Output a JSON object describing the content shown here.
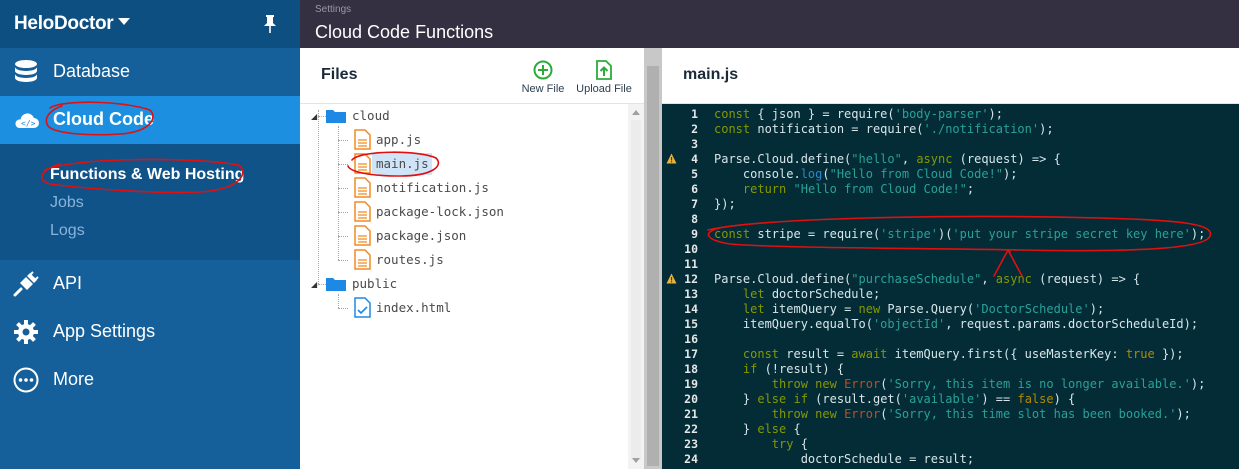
{
  "app": {
    "name": "HeloDoctor"
  },
  "sidebar": {
    "items": [
      {
        "label": "Database",
        "icon": "database-icon"
      },
      {
        "label": "Cloud Code",
        "icon": "cloud-code-icon"
      },
      {
        "label": "API",
        "icon": "plug-icon"
      },
      {
        "label": "App Settings",
        "icon": "gear-icon"
      },
      {
        "label": "More",
        "icon": "more-icon"
      }
    ],
    "subitems": [
      "Functions & Web Hosting",
      "Jobs",
      "Logs"
    ]
  },
  "topbar": {
    "breadcrumb": "Settings",
    "title": "Cloud Code Functions"
  },
  "files": {
    "title": "Files",
    "new_file": "New File",
    "upload_file": "Upload File",
    "folders": [
      "cloud",
      "public"
    ],
    "cloud_files": [
      "app.js",
      "main.js",
      "notification.js",
      "package-lock.json",
      "package.json",
      "routes.js"
    ],
    "public_files": [
      "index.html"
    ],
    "selected": "main.js"
  },
  "editor": {
    "filename": "main.js",
    "lines": [
      "const { json } = require('body-parser');",
      "const notification = require('./notification');",
      "",
      "Parse.Cloud.define(\"hello\", async (request) => {",
      "    console.log(\"Hello from Cloud Code!\");",
      "    return \"Hello from Cloud Code!\";",
      "});",
      "",
      "const stripe = require('stripe')('put your stripe secret key here');",
      "",
      "",
      "Parse.Cloud.define(\"purchaseSchedule\", async (request) => {",
      "    let doctorSchedule;",
      "    let itemQuery = new Parse.Query('DoctorSchedule');",
      "    itemQuery.equalTo('objectId', request.params.doctorScheduleId);",
      "",
      "    const result = await itemQuery.first({ useMasterKey: true });",
      "    if (!result) {",
      "        throw new Error('Sorry, this item is no longer available.');",
      "    } else if (result.get('available') == false) {",
      "        throw new Error('Sorry, this time slot has been booked.');",
      "    } else {",
      "        try {",
      "            doctorSchedule = result;"
    ],
    "warning_lines": [
      4,
      12
    ]
  },
  "colors": {
    "sidebar": "#15609a",
    "sidebar_active": "#1c8fe0",
    "topbar": "#343042",
    "editor_bg": "#032c37",
    "annotation": "#e01010"
  }
}
